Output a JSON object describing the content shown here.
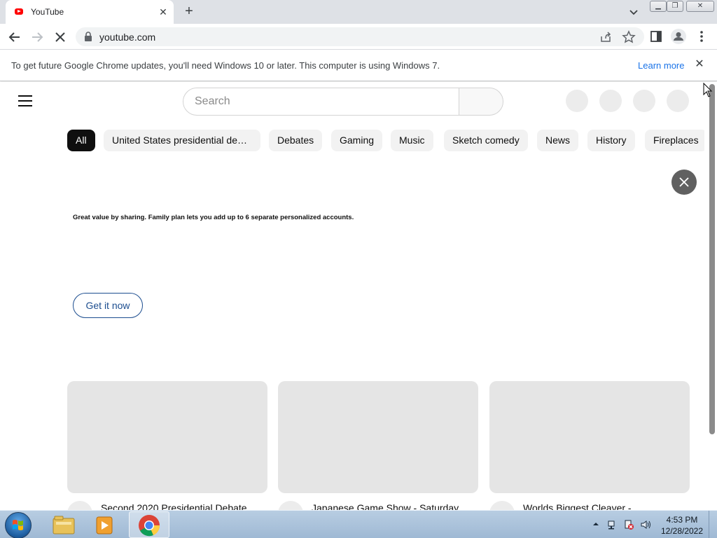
{
  "browser": {
    "tab_title": "YouTube",
    "url": "youtube.com",
    "infobar_message": "To get future Google Chrome updates, you'll need Windows 10 or later. This computer is using Windows 7.",
    "infobar_link": "Learn more"
  },
  "youtube": {
    "search_placeholder": "Search",
    "chips": [
      {
        "label": "All",
        "active": true
      },
      {
        "label": "United States presidential de…",
        "active": false
      },
      {
        "label": "Debates",
        "active": false
      },
      {
        "label": "Gaming",
        "active": false
      },
      {
        "label": "Music",
        "active": false
      },
      {
        "label": "Sketch comedy",
        "active": false
      },
      {
        "label": "News",
        "active": false
      },
      {
        "label": "History",
        "active": false
      },
      {
        "label": "Fireplaces",
        "active": false
      }
    ],
    "promo": {
      "text": "Great value by sharing. Family plan lets you add up to 6 separate personalized accounts.",
      "button": "Get it now"
    },
    "videos": [
      {
        "title": "Second 2020 Presidential Debate"
      },
      {
        "title": "Japanese Game Show - Saturday"
      },
      {
        "title": "Worlds Biggest Cleaver -"
      }
    ]
  },
  "taskbar": {
    "time": "4:53 PM",
    "date": "12/28/2022"
  },
  "colors": {
    "youtube_red": "#ff0000",
    "chip_active": "#0f0f0f",
    "link_blue": "#1a73e8",
    "promo_button": "#1c4d8f"
  },
  "icons": [
    "lock-icon",
    "share-icon",
    "star-icon",
    "side-panel-icon",
    "profile-icon",
    "kebab-menu-icon",
    "hamburger-icon",
    "close-icon",
    "windows-start-icon",
    "explorer-icon",
    "media-player-icon",
    "chrome-icon"
  ]
}
